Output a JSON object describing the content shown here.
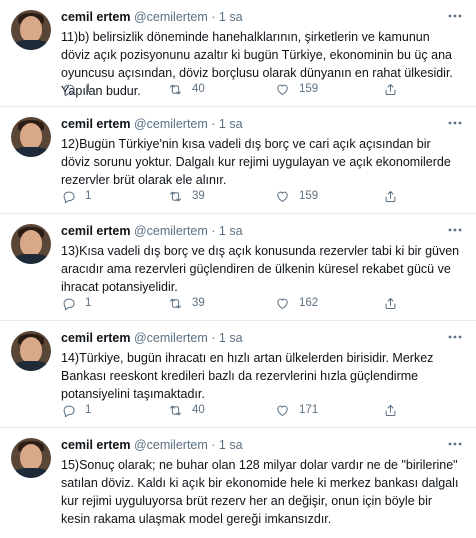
{
  "tweets": [
    {
      "name": "cemil ertem",
      "handle": "@cemilertem",
      "sep": "·",
      "time": "1 sa",
      "text": "11)b) belirsizlik döneminde hanehalklarının, şirketlerin ve kamunun döviz açık pozisyonunu azaltır ki bugün Türkiye, ekonominin bu üç ana oyuncusu açısından, döviz borçlusu olarak dünyanın en rahat ülkesidir. Yapılan budur.",
      "replies": "1",
      "retweets": "40",
      "likes": "159"
    },
    {
      "name": "cemil ertem",
      "handle": "@cemilertem",
      "sep": "·",
      "time": "1 sa",
      "text": "12)Bugün Türkiye'nin kısa vadeli dış borç ve cari açık açısından bir döviz sorunu yoktur. Dalgalı kur rejimi uygulayan ve açık ekonomilerde rezervler brüt olarak ele alınır.",
      "replies": "1",
      "retweets": "39",
      "likes": "159"
    },
    {
      "name": "cemil ertem",
      "handle": "@cemilertem",
      "sep": "·",
      "time": "1 sa",
      "text": "13)Kısa vadeli dış borç ve dış açık konusunda rezervler tabi ki bir güven aracıdır ama rezervleri güçlendiren de ülkenin küresel rekabet gücü ve ihracat potansiyelidir.",
      "replies": "1",
      "retweets": "39",
      "likes": "162"
    },
    {
      "name": "cemil ertem",
      "handle": "@cemilertem",
      "sep": "·",
      "time": "1 sa",
      "text": "14)Türkiye, bugün ihracatı en hızlı artan ülkelerden birisidir. Merkez Bankası reeskont kredileri bazlı da rezervlerini hızla güçlendirme potansiyelini taşımaktadır.",
      "replies": "1",
      "retweets": "40",
      "likes": "171"
    },
    {
      "name": "cemil ertem",
      "handle": "@cemilertem",
      "sep": "·",
      "time": "1 sa",
      "text": "15)Sonuç olarak; ne buhar olan 128 milyar dolar vardır ne de \"birilerine\" satılan döviz. Kaldı ki açık bir ekonomide hele ki merkez bankası dalgalı kur rejimi uyguluyorsa brüt rezerv her an değişir, onun için böyle bir kesin rakama ulaşmak model gereği imkansızdır.",
      "replies": "",
      "retweets": "",
      "likes": ""
    }
  ],
  "colors": {
    "text": "#0f1419",
    "muted": "#5b7083",
    "divider": "#e6ecf0"
  },
  "icons": [
    "reply-icon",
    "retweet-icon",
    "like-icon",
    "share-icon",
    "more-icon"
  ]
}
